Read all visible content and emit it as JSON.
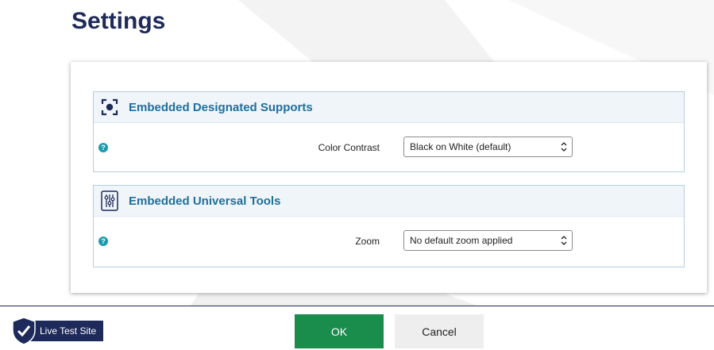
{
  "page": {
    "title": "Settings"
  },
  "sections": [
    {
      "title": "Embedded Designated Supports",
      "icon": "focus-target-icon",
      "setting": {
        "label": "Color Contrast",
        "value": "Black on White (default)"
      }
    },
    {
      "title": "Embedded Universal Tools",
      "icon": "sliders-icon",
      "setting": {
        "label": "Zoom",
        "value": "No default zoom applied"
      }
    }
  ],
  "footer": {
    "badge_label": "Live Test Site",
    "ok_label": "OK",
    "cancel_label": "Cancel"
  },
  "colors": {
    "title": "#1d2a5a",
    "section_title": "#1f6f9c",
    "ok_button": "#1a8c4c",
    "help_icon": "#1a9bb0",
    "badge": "#1d2a5a"
  }
}
